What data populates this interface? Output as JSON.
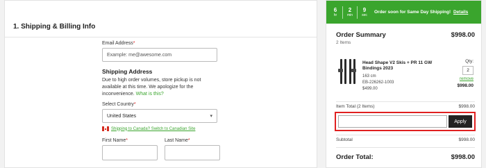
{
  "shipping": {
    "section_title": "1. Shipping & Billing Info",
    "email_label": "Email Address",
    "email_placeholder": "Example: me@awesome.com",
    "address_heading": "Shipping Address",
    "notice": "Due to high order volumes, store pickup is not available at this time. We apologize for the inconvenience.",
    "notice_link": "What is this?",
    "country_label": "Select Country",
    "country_value": "United States",
    "canada_link": "Shipping to Canada? Switch to Canadian Site",
    "first_name_label": "First Name",
    "last_name_label": "Last Name",
    "required_mark": "*"
  },
  "banner": {
    "hours": "6",
    "hours_unit": "hr",
    "minutes": "2",
    "minutes_unit": "min",
    "seconds": "9",
    "seconds_unit": "sec",
    "message": "Order soon for Same Day Shipping!",
    "details_link": "Details",
    "color": "#3aa52d"
  },
  "summary": {
    "title": "Order Summary",
    "total": "$998.00",
    "items_count": "2 Items",
    "product": {
      "name": "Head Shape V2 Skis + PR 11 GW Bindings 2023",
      "size": "163 cm",
      "sku": "EB-226262-1003",
      "unit_price": "$499.00",
      "qty_label": "Qty:",
      "qty": "2",
      "remove": "remove",
      "line_total": "$998.00"
    },
    "item_total_label": "Item Total (2 Items)",
    "item_total": "$998.00",
    "apply_label": "Apply",
    "subtotal_label": "Subtotal",
    "subtotal": "$998.00",
    "order_total_label": "Order Total:",
    "order_total": "$998.00"
  },
  "icons": {
    "chevron": "chevron-down-icon",
    "flag": "canada-flag-icon",
    "product": "ski-product-image"
  }
}
